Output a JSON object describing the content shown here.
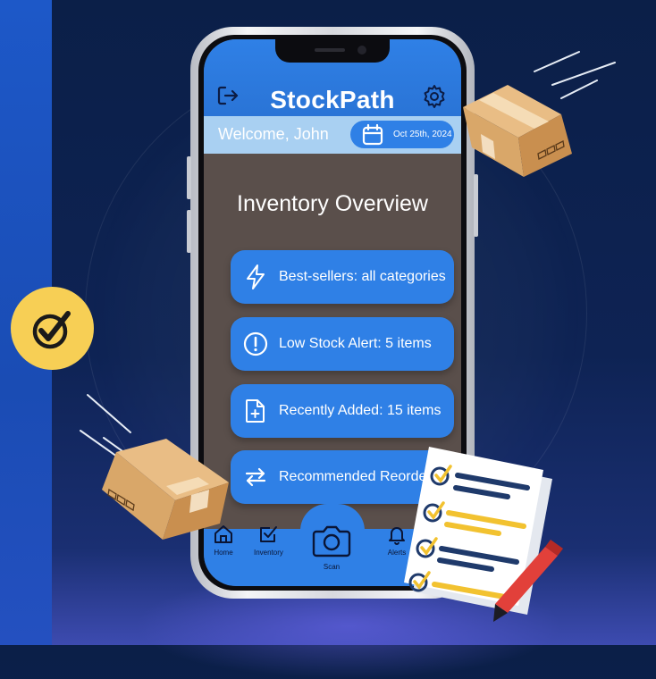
{
  "app": {
    "title": "StockPath"
  },
  "header": {
    "welcome": "Welcome,  John",
    "date": "Oct 25th, 2024"
  },
  "main": {
    "heading": "Inventory Overview",
    "items": [
      {
        "label": "Best-sellers: all categories",
        "icon": "lightning-icon"
      },
      {
        "label": "Low Stock Alert: 5 items",
        "icon": "alert-icon"
      },
      {
        "label": "Recently Added: 15 items",
        "icon": "file-add-icon"
      },
      {
        "label": "Recommended Reorders",
        "icon": "reorder-icon"
      }
    ]
  },
  "nav": {
    "home": "Home",
    "inventory": "Inventory",
    "scan": "Scan",
    "alerts": "Alerts"
  },
  "colors": {
    "primary": "#2f80e6",
    "welcome_bar": "#a9d0f2",
    "screen_bg": "#5a4f4b",
    "badge": "#f7cf55"
  }
}
